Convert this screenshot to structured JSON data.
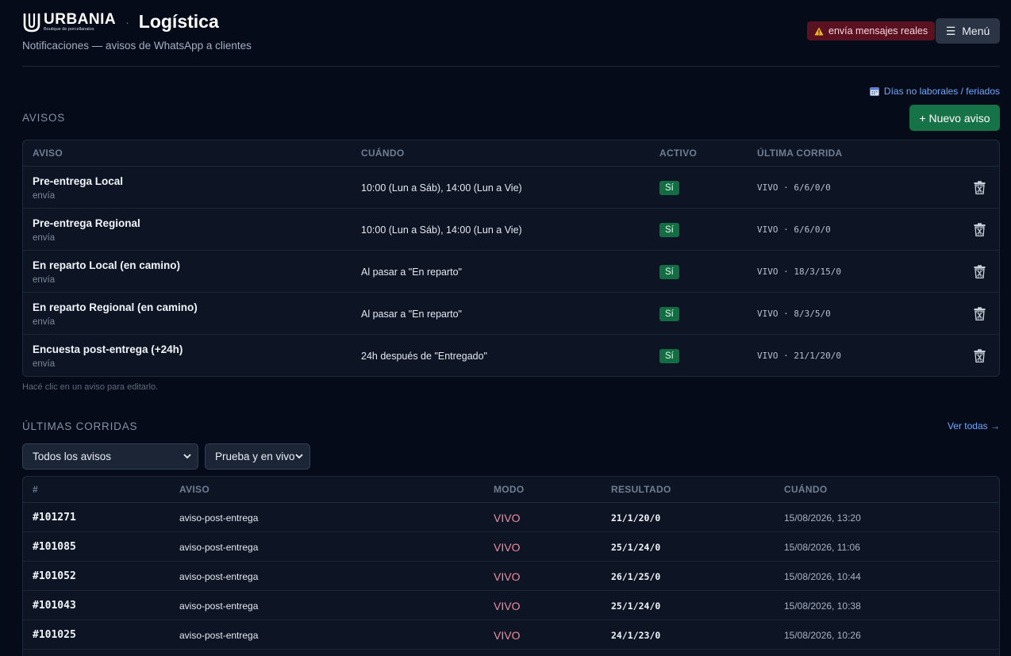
{
  "header": {
    "logo_name": "URBANIA",
    "logo_tagline": "Boutique de porcellanatos",
    "title": "Logística",
    "subtitle": "Notificaciones — avisos de WhatsApp a clientes",
    "warning_badge": "envía mensajes reales",
    "menu_label": "Menú"
  },
  "avisos": {
    "holidays_link": "Días no laborales / feriados",
    "section_title": "AVISOS",
    "new_button": "+ Nuevo aviso",
    "columns": [
      "AVISO",
      "CUÁNDO",
      "ACTIVO",
      "ÚLTIMA CORRIDA"
    ],
    "rows": [
      {
        "name": "Pre-entrega Local",
        "sub": "envía",
        "when": "10:00 (Lun a Sáb), 14:00 (Lun a Vie)",
        "active": "Sí",
        "last_run": "VIVO · 6/6/0/0"
      },
      {
        "name": "Pre-entrega Regional",
        "sub": "envía",
        "when": "10:00 (Lun a Sáb), 14:00 (Lun a Vie)",
        "active": "Sí",
        "last_run": "VIVO · 6/6/0/0"
      },
      {
        "name": "En reparto Local (en camino)",
        "sub": "envía",
        "when": "Al pasar a \"En reparto\"",
        "active": "Sí",
        "last_run": "VIVO · 18/3/15/0"
      },
      {
        "name": "En reparto Regional (en camino)",
        "sub": "envía",
        "when": "Al pasar a \"En reparto\"",
        "active": "Sí",
        "last_run": "VIVO · 8/3/5/0"
      },
      {
        "name": "Encuesta post-entrega (+24h)",
        "sub": "envía",
        "when": "24h después de \"Entregado\"",
        "active": "Sí",
        "last_run": "VIVO · 21/1/20/0"
      }
    ],
    "hint": "Hacé clic en un aviso para editarlo."
  },
  "runs": {
    "section_title": "ÚLTIMAS CORRIDAS",
    "see_all": "Ver todas →",
    "filter_aviso": "Todos los avisos",
    "filter_mode": "Prueba y en vivo",
    "columns": [
      "#",
      "AVISO",
      "MODO",
      "RESULTADO",
      "CUÁNDO"
    ],
    "rows": [
      {
        "id": "#101271",
        "aviso": "aviso-post-entrega",
        "mode": "VIVO",
        "result": "21/1/20/0",
        "when": "15/08/2026, 13:20"
      },
      {
        "id": "#101085",
        "aviso": "aviso-post-entrega",
        "mode": "VIVO",
        "result": "25/1/24/0",
        "when": "15/08/2026, 11:06"
      },
      {
        "id": "#101052",
        "aviso": "aviso-post-entrega",
        "mode": "VIVO",
        "result": "26/1/25/0",
        "when": "15/08/2026, 10:44"
      },
      {
        "id": "#101043",
        "aviso": "aviso-post-entrega",
        "mode": "VIVO",
        "result": "25/1/24/0",
        "when": "15/08/2026, 10:38"
      },
      {
        "id": "#101025",
        "aviso": "aviso-post-entrega",
        "mode": "VIVO",
        "result": "24/1/23/0",
        "when": "15/08/2026, 10:26"
      }
    ]
  },
  "colors": {
    "background": "#050b18",
    "card": "#0d1524",
    "accent_green": "#157347",
    "link": "#6ea8fe",
    "danger_badge": "#5a1220",
    "mode_live": "#f08ca0"
  },
  "icons": [
    "logo-icon",
    "warning-icon",
    "menu-icon",
    "calendar-icon",
    "trash-icon",
    "chevron-down-icon"
  ]
}
